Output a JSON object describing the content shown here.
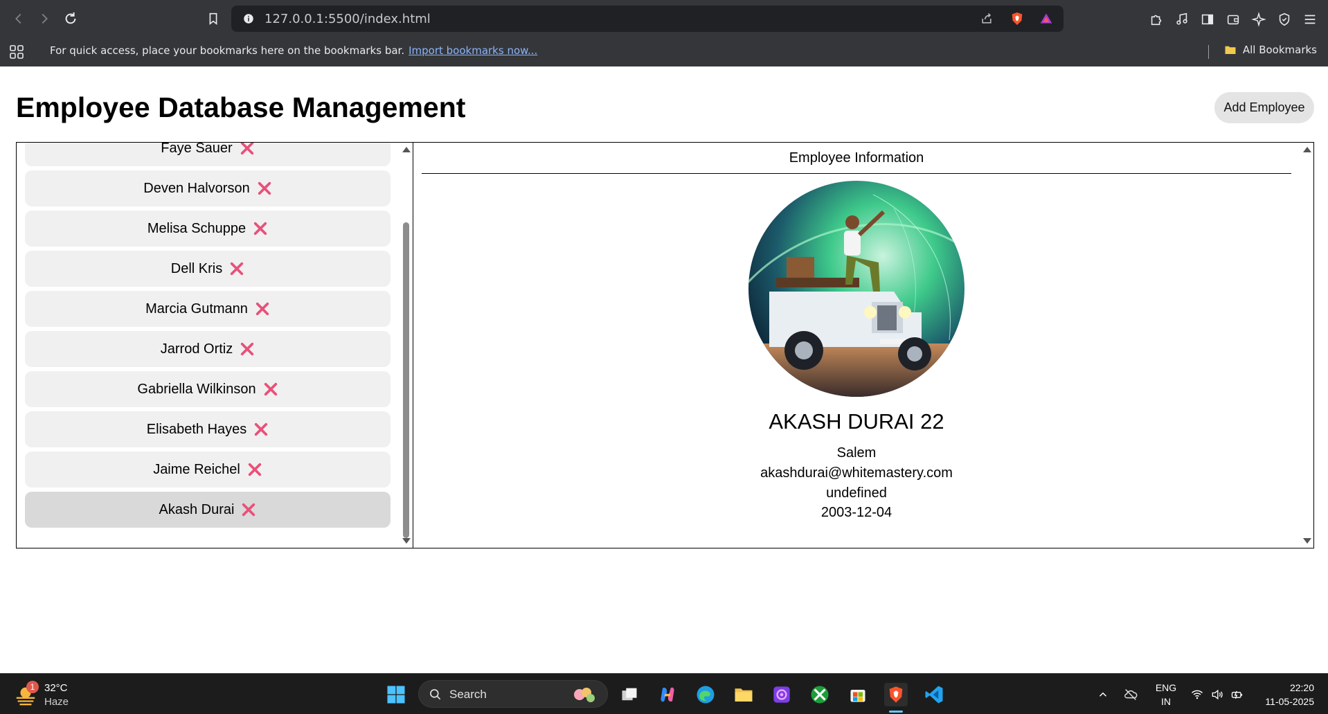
{
  "browser": {
    "url": "127.0.0.1:5500/index.html",
    "bookmarks_prompt": "For quick access, place your bookmarks here on the bookmarks bar.",
    "bookmarks_link": "Import bookmarks now...",
    "all_bookmarks": "All Bookmarks"
  },
  "page": {
    "title": "Employee Database Management",
    "add_button": "Add Employee"
  },
  "employees": [
    {
      "name": "Faye Sauer"
    },
    {
      "name": "Deven Halvorson"
    },
    {
      "name": "Melisa Schuppe"
    },
    {
      "name": "Dell Kris"
    },
    {
      "name": "Marcia Gutmann"
    },
    {
      "name": "Jarrod Ortiz"
    },
    {
      "name": "Gabriella Wilkinson"
    },
    {
      "name": "Elisabeth Hayes"
    },
    {
      "name": "Jaime Reichel"
    },
    {
      "name": "Akash Durai",
      "selected": true
    }
  ],
  "info": {
    "heading": "Employee Information",
    "name": "AKASH DURAI 22",
    "city": "Salem",
    "email": "akashdurai@whitemastery.com",
    "phone": "undefined",
    "dob": "2003-12-04"
  },
  "taskbar": {
    "weather_temp": "32°C",
    "weather_desc": "Haze",
    "weather_badge": "1",
    "search_label": "Search",
    "lang_top": "ENG",
    "lang_bottom": "IN",
    "time": "22:20",
    "date": "11-05-2025"
  },
  "colors": {
    "delete_icon": "#e8507a",
    "accent": "#60cdff"
  }
}
